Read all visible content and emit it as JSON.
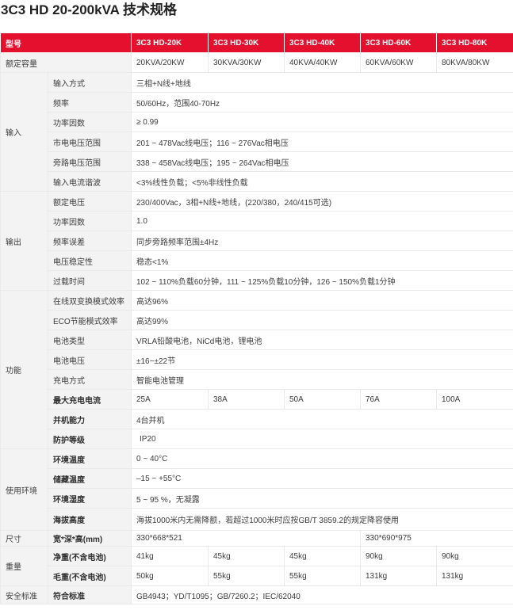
{
  "title": "3C3 HD 20-200kVA 技术规格",
  "header": {
    "label": "型号",
    "models": [
      "3C3 HD-20K",
      "3C3 HD-30K",
      "3C3 HD-40K",
      "3C3 HD-60K",
      "3C3 HD-80K"
    ]
  },
  "rated_capacity": {
    "label": "额定容量",
    "values": [
      "20KVA/20KW",
      "30KVA/30KW",
      "40KVA/40KW",
      "60KVA/60KW",
      "80KVA/80KW"
    ]
  },
  "input": {
    "category": "输入",
    "rows": [
      {
        "label": "输入方式",
        "value": "三相+N线+地线"
      },
      {
        "label": "频率",
        "value": "50/60Hz，范围40-70Hz"
      },
      {
        "label": "功率因数",
        "value": "≥ 0.99"
      },
      {
        "label": "市电电压范围",
        "value": "201 ~ 478Vac线电压；116 ~ 276Vac相电压"
      },
      {
        "label": "旁路电压范围",
        "value": "338 ~ 458Vac线电压；195 ~ 264Vac相电压"
      },
      {
        "label": "输入电流谐波",
        "value": "<3%线性负载；<5%非线性负载"
      }
    ]
  },
  "output": {
    "category": "输出",
    "rows": [
      {
        "label": "额定电压",
        "value": "230/400Vac，3相+N线+地线，(220/380，240/415可选)"
      },
      {
        "label": "功率因数",
        "value": "1.0"
      },
      {
        "label": "频率误差",
        "value": "同步旁路频率范围±4Hz"
      },
      {
        "label": "电压稳定性",
        "value": "稳态<1%"
      },
      {
        "label": "过载时间",
        "value": "102 ~ 110%负载60分钟，111 ~ 125%负载10分钟，126 ~ 150%负载1分钟"
      }
    ]
  },
  "function": {
    "category": "功能",
    "rows": [
      {
        "label": "在线双变换模式效率",
        "value": "高达96%"
      },
      {
        "label": "ECO节能模式效率",
        "value": "高达99%"
      },
      {
        "label": "电池类型",
        "value": "VRLA铅酸电池，NiCd电池，锂电池"
      },
      {
        "label": "电池电压",
        "value": "±16~±22节"
      },
      {
        "label": "充电方式",
        "value": "智能电池管理"
      }
    ],
    "max_charge": {
      "label": "最大充电电流",
      "values": [
        "25A",
        "38A",
        "50A",
        "76A",
        "100A"
      ]
    },
    "parallel": {
      "label": "并机能力",
      "value": "4台并机"
    },
    "protection": {
      "label": "防护等级",
      "value": "IP20"
    }
  },
  "environment": {
    "category": "使用环境",
    "rows": [
      {
        "label": "环境温度",
        "value": "0 ~ 40°C"
      },
      {
        "label": "储藏温度",
        "value": "–15 ~ +55°C"
      },
      {
        "label": "环境湿度",
        "value": "5 ~ 95 %，无凝露"
      },
      {
        "label": "海拔高度",
        "value": "海拔1000米内无需降额，若超过1000米时应按GB/T 3859.2的规定降容使用"
      }
    ]
  },
  "size": {
    "category": "尺寸",
    "label": "宽*深*高(mm)",
    "value_a": "330*668*521",
    "value_b": "330*690*975"
  },
  "weight": {
    "category": "重量",
    "net": {
      "label": "净重(不含电池)",
      "values": [
        "41kg",
        "45kg",
        "45kg",
        "90kg",
        "90kg"
      ]
    },
    "gross": {
      "label": "毛重(不含电池)",
      "values": [
        "50kg",
        "55kg",
        "55kg",
        "131kg",
        "131kg"
      ]
    }
  },
  "safety": {
    "category": "安全标准",
    "label": "符合标准",
    "value": "GB4943；YD/T1095；GB/7260.2；IEC/62040"
  }
}
